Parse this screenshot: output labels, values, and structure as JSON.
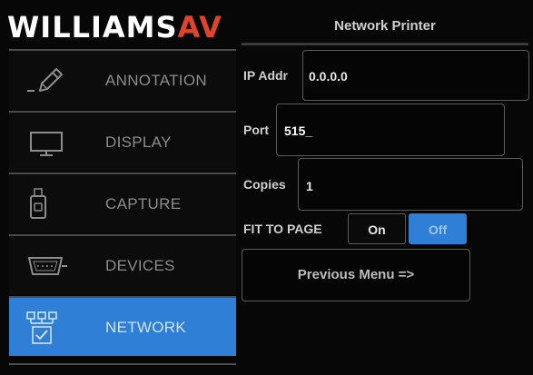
{
  "header": {
    "logo_text": "WILLIAMS",
    "logo_av": "AV",
    "title": "Network Printer"
  },
  "sidebar": {
    "items": [
      {
        "label": "ANNOTATION",
        "icon": "pencil-icon",
        "active": false
      },
      {
        "label": "DISPLAY",
        "icon": "monitor-icon",
        "active": false
      },
      {
        "label": "CAPTURE",
        "icon": "usb-drive-icon",
        "active": false
      },
      {
        "label": "DEVICES",
        "icon": "serial-port-icon",
        "active": false
      },
      {
        "label": "NETWORK",
        "icon": "network-icon",
        "active": true
      }
    ]
  },
  "network_printer": {
    "ip": {
      "label": "IP Addr",
      "value": "0.0.0.0"
    },
    "port": {
      "label": "Port",
      "value": "515_"
    },
    "copies": {
      "label": "Copies",
      "value": "1"
    },
    "fit_to_page": {
      "label": "FIT TO PAGE",
      "on_label": "On",
      "off_label": "Off",
      "selected": "Off"
    },
    "previous_menu_label": "Previous Menu =>"
  },
  "colors": {
    "accent": "#2f7fd6",
    "logo_av": "#e0442c",
    "background": "#070707"
  }
}
